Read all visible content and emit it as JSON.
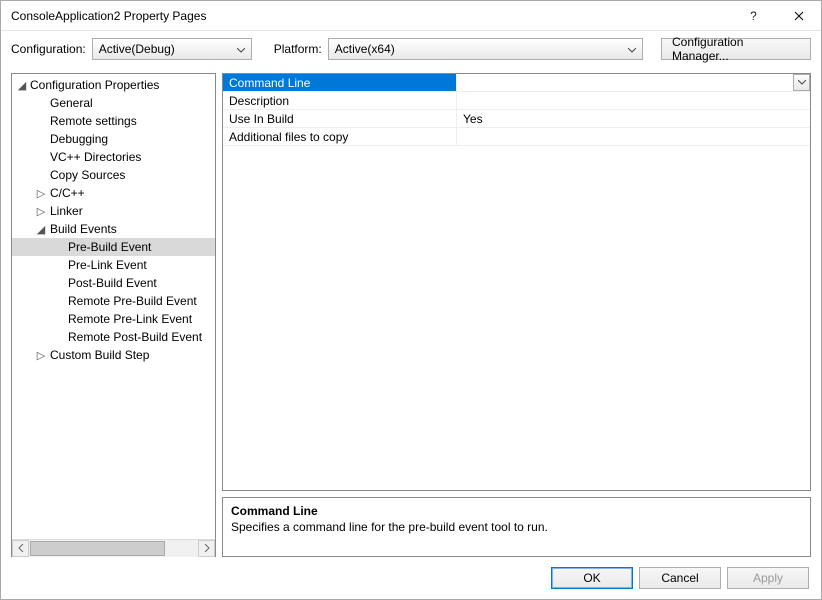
{
  "window": {
    "title": "ConsoleApplication2 Property Pages"
  },
  "config_row": {
    "config_label": "Configuration:",
    "config_value": "Active(Debug)",
    "platform_label": "Platform:",
    "platform_value": "Active(x64)",
    "manager_button": "Configuration Manager..."
  },
  "tree": {
    "root": "Configuration Properties",
    "items": [
      {
        "label": "General",
        "depth": 1,
        "exp": "",
        "sel": false
      },
      {
        "label": "Remote settings",
        "depth": 1,
        "exp": "",
        "sel": false
      },
      {
        "label": "Debugging",
        "depth": 1,
        "exp": "",
        "sel": false
      },
      {
        "label": "VC++ Directories",
        "depth": 1,
        "exp": "",
        "sel": false
      },
      {
        "label": "Copy Sources",
        "depth": 1,
        "exp": "",
        "sel": false
      },
      {
        "label": "C/C++",
        "depth": 1,
        "exp": "▷",
        "sel": false
      },
      {
        "label": "Linker",
        "depth": 1,
        "exp": "▷",
        "sel": false
      },
      {
        "label": "Build Events",
        "depth": 1,
        "exp": "◢",
        "sel": false
      },
      {
        "label": "Pre-Build Event",
        "depth": 2,
        "exp": "",
        "sel": true
      },
      {
        "label": "Pre-Link Event",
        "depth": 2,
        "exp": "",
        "sel": false
      },
      {
        "label": "Post-Build Event",
        "depth": 2,
        "exp": "",
        "sel": false
      },
      {
        "label": "Remote Pre-Build Event",
        "depth": 2,
        "exp": "",
        "sel": false
      },
      {
        "label": "Remote Pre-Link Event",
        "depth": 2,
        "exp": "",
        "sel": false
      },
      {
        "label": "Remote Post-Build Event",
        "depth": 2,
        "exp": "",
        "sel": false
      },
      {
        "label": "Custom Build Step",
        "depth": 1,
        "exp": "▷",
        "sel": false
      }
    ]
  },
  "grid": [
    {
      "key": "Command Line",
      "value": "",
      "sel": true
    },
    {
      "key": "Description",
      "value": "",
      "sel": false
    },
    {
      "key": "Use In Build",
      "value": "Yes",
      "sel": false
    },
    {
      "key": "Additional files to copy",
      "value": "",
      "sel": false
    }
  ],
  "description": {
    "title": "Command Line",
    "text": "Specifies a command line for the pre-build event tool to run."
  },
  "footer": {
    "ok": "OK",
    "cancel": "Cancel",
    "apply": "Apply"
  }
}
